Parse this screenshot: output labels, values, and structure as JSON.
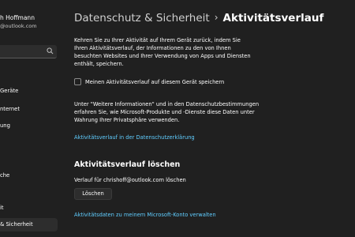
{
  "user": {
    "name": "h Hoffmann",
    "email": "@outlook.com"
  },
  "sidebar": {
    "items": [
      {
        "label": "Geräte"
      },
      {
        "label": "nternet"
      },
      {
        "label": "ung"
      },
      {
        "label": "che"
      },
      {
        "label": "it"
      },
      {
        "label": "& Sicherheit"
      }
    ]
  },
  "header": {
    "parent": "Datenschutz & Sicherheit",
    "separator": "›",
    "current": "Aktivitätsverlauf"
  },
  "content": {
    "description": "Kehren Sie zu Ihrer Aktivität auf Ihrem Gerät zurück, indem Sie Ihren Aktivitätsverlauf, der Informationen zu den von Ihnen besuchten Websites und Ihrer Verwendung von Apps und Diensten enthält, speichern.",
    "checkbox_label": "Meinen Aktivitätsverlauf auf diesem Gerät speichern",
    "checkbox_checked": false,
    "info_text": "Unter \"Weitere Informationen\" und in den Datenschutzbestimmungen erfahren Sie, wie Microsoft-Produkte und -Dienste diese Daten unter Wahrung Ihrer Privatsphäre verwenden.",
    "privacy_link": "Aktivitätsverlauf in der Datenschutzerklärung",
    "clear_section_title": "Aktivitätsverlauf löschen",
    "clear_label": "Verlauf für chrishoff@outlook.com löschen",
    "clear_button": "Löschen",
    "manage_link": "Aktivitätsdaten zu meinem Microsoft-Konto verwalten"
  },
  "icons": {
    "search": "search-icon"
  },
  "colors": {
    "background": "#202020",
    "link": "#60cdff",
    "text": "#ffffff"
  }
}
